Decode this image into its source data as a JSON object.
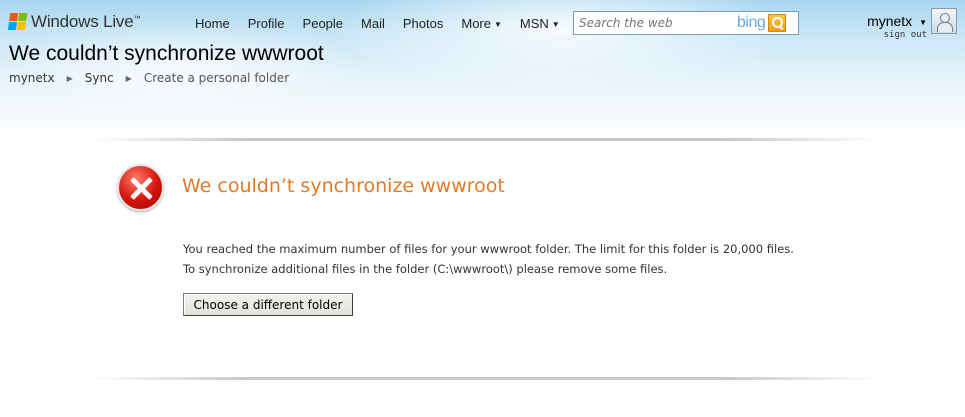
{
  "header": {
    "brand": "Windows Live",
    "brand_tm": "™",
    "nav": [
      {
        "label": "Home",
        "has_menu": false
      },
      {
        "label": "Profile",
        "has_menu": false
      },
      {
        "label": "People",
        "has_menu": false
      },
      {
        "label": "Mail",
        "has_menu": false
      },
      {
        "label": "Photos",
        "has_menu": false
      },
      {
        "label": "More",
        "has_menu": true
      },
      {
        "label": "MSN",
        "has_menu": true
      }
    ],
    "search": {
      "placeholder": "Search the web",
      "value": "",
      "logo": "bing"
    },
    "user": {
      "name": "mynetx",
      "signout": "sign out"
    },
    "avatar_icon": "user-avatar-icon"
  },
  "page": {
    "title": "We couldn’t synchronize wwwroot",
    "breadcrumb": [
      {
        "label": "mynetx"
      },
      {
        "label": "Sync"
      },
      {
        "label": "Create a personal folder"
      }
    ]
  },
  "error": {
    "icon": "error-icon",
    "title": "We couldn’t synchronize wwwroot",
    "line1": "You reached the maximum number of files for your wwwroot folder. The limit for this folder is 20,000 files.",
    "line2": "To synchronize additional files in the folder (C:\\wwwroot\\) please remove some files.",
    "button_label": "Choose a different folder"
  },
  "colors": {
    "error_title": "#e27a2a",
    "error_icon": "#d4120a",
    "bing_button": "#f59b12"
  }
}
